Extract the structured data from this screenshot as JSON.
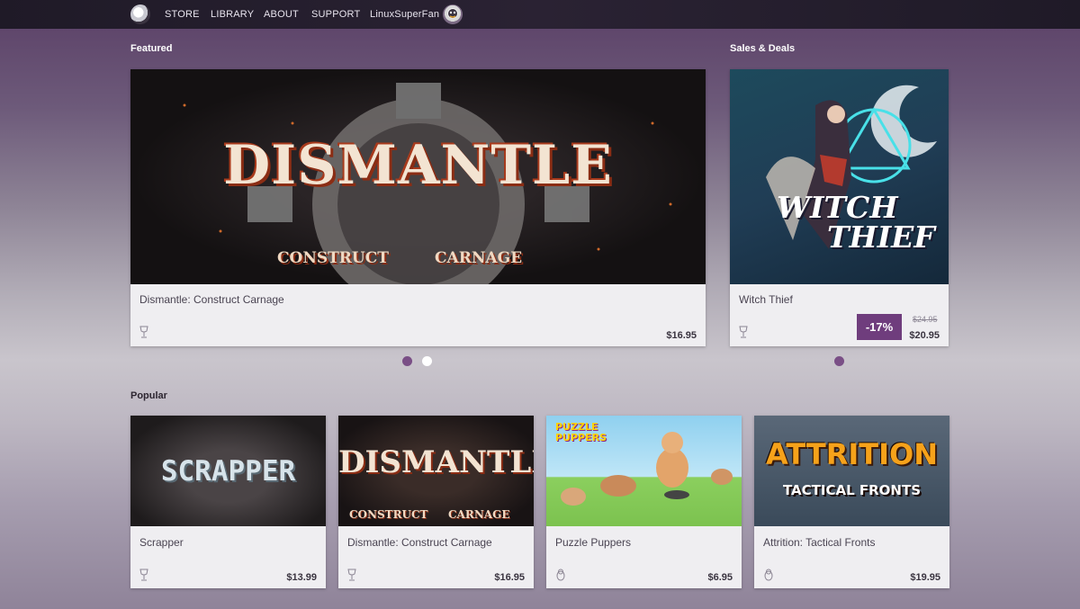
{
  "nav": {
    "items": [
      "STORE",
      "LIBRARY",
      "ABOUT",
      "SUPPORT"
    ],
    "username": "LinuxSuperFan",
    "logo_icon": "gamehub-logo-icon",
    "avatar_icon": "user-avatar-icon"
  },
  "featured": {
    "title": "Featured",
    "card": {
      "name": "Dismantle: Construct Carnage",
      "price": "$16.95",
      "platform_icon": "wine-glass-icon",
      "art_title": "DISMANTLE",
      "art_subtitle_left": "CONSTRUCT",
      "art_subtitle_right": "CARNAGE"
    },
    "carousel_active_index": 1
  },
  "sales": {
    "title": "Sales & Deals",
    "card": {
      "name": "Witch Thief",
      "discount": "-17%",
      "old_price": "$24.95",
      "price": "$20.95",
      "platform_icon": "wine-glass-icon",
      "art_title_line1": "WITCH",
      "art_title_line2": "THIEF"
    }
  },
  "popular": {
    "title": "Popular",
    "cards": [
      {
        "name": "Scrapper",
        "price": "$13.99",
        "platform_icon": "wine-glass-icon",
        "art_title": "SCRAPPER"
      },
      {
        "name": "Dismantle: Construct Carnage",
        "price": "$16.95",
        "platform_icon": "wine-glass-icon",
        "art_title": "DISMANTLE",
        "art_subtitle_left": "CONSTRUCT",
        "art_subtitle_right": "CARNAGE"
      },
      {
        "name": "Puzzle Puppers",
        "price": "$6.95",
        "platform_icon": "linux-tux-icon",
        "art_title_line1": "PUZZLE",
        "art_title_line2": "PUPPERS"
      },
      {
        "name": "Attrition: Tactical Fronts",
        "price": "$19.95",
        "platform_icon": "linux-tux-icon",
        "art_title": "ATTRITION",
        "art_subtitle": "TACTICAL FRONTS"
      }
    ]
  },
  "colors": {
    "accent": "#6f3d7d",
    "topbar": "#1f1a27",
    "card_bg": "#efeef1"
  }
}
